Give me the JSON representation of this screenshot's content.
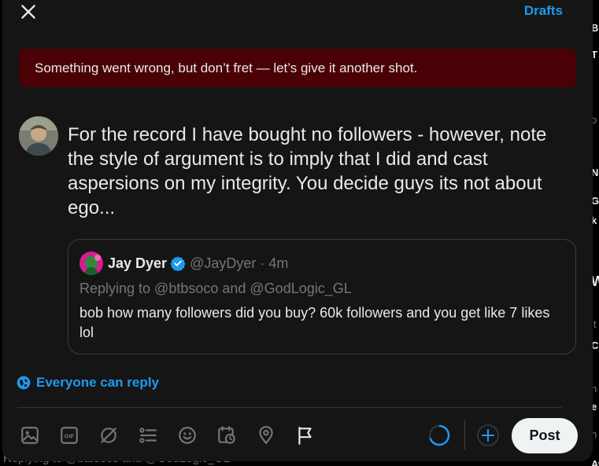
{
  "header": {
    "drafts_label": "Drafts",
    "close_icon": "close-icon"
  },
  "error_banner": {
    "text": "Something went wrong, but don’t fret — let’s give it another shot."
  },
  "composer": {
    "text": "For the record I have bought no followers - however, note the style of argument is to imply that I did and cast aspersions on my integrity. You decide guys its not about ego..."
  },
  "quote": {
    "name": "Jay Dyer",
    "handle_time": "@JayDyer · 4m",
    "replying": "Replying to @btbsoco and @GodLogic_GL",
    "body": "bob how many followers did you buy? 60k followers and you get like 7 likes lol"
  },
  "reply_setting": {
    "label": "Everyone can reply"
  },
  "toolbar": {
    "icons": [
      "image-icon",
      "gif-icon",
      "grok-icon",
      "poll-icon",
      "emoji-icon",
      "schedule-icon",
      "location-icon",
      "flag-icon"
    ],
    "post_label": "Post"
  },
  "background": {
    "bottom_text": "Replying to @btbsoco and @GodLogic_GL",
    "right_fragments": [
      "B",
      "T",
      "o",
      "N",
      "G",
      "k",
      "W",
      "it",
      "C",
      "n",
      "e",
      "n",
      "Aw"
    ]
  },
  "colors": {
    "accent": "#1d9bf0",
    "error_bg": "#4a0106",
    "modal_bg": "#151515"
  }
}
